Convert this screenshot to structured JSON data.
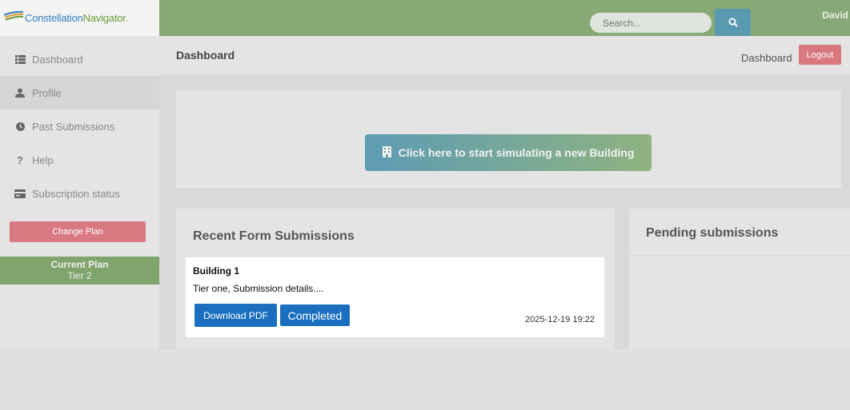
{
  "brand": {
    "name_part1": "Constellation",
    "name_part2": "Navigator",
    "suffix": "."
  },
  "sidebar": {
    "items": [
      {
        "label": "Dashboard",
        "icon": "list-icon"
      },
      {
        "label": "Profile",
        "icon": "user-icon"
      },
      {
        "label": "Past Submissions",
        "icon": "clock-icon"
      },
      {
        "label": "Help",
        "icon": "question-icon"
      },
      {
        "label": "Subscription status",
        "icon": "card-icon"
      }
    ],
    "change_plan_label": "Change Plan",
    "current_plan_label": "Current Plan",
    "current_plan_value": "Tier 2"
  },
  "topbar": {
    "search_placeholder": "Search...",
    "user_name": "David"
  },
  "header": {
    "title": "Dashboard",
    "breadcrumb": "Dashboard",
    "logout_label": "Logout"
  },
  "main": {
    "start_button_label": "Click here to start simulating a new Building",
    "recent_title": "Recent Form Submissions",
    "pending_title": "Pending submissions",
    "submissions": [
      {
        "name": "Building 1",
        "description": "Tier one, Submission details....",
        "download_label": "Download PDF",
        "status": "Completed",
        "timestamp": "2025-12-19 19:22"
      }
    ]
  },
  "colors": {
    "topbar": "#88aa74",
    "accent_red": "#d97a83",
    "plan_green": "#7fa46c",
    "primary_blue": "#1b6fbf"
  }
}
